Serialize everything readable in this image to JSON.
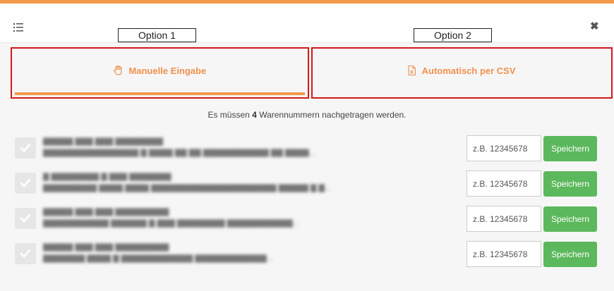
{
  "header": {
    "list_icon": "list-ordered-icon",
    "close_icon": "close-icon",
    "close_glyph": "✖"
  },
  "options": [
    {
      "label": "Option 1"
    },
    {
      "label": "Option 2"
    }
  ],
  "tabs": [
    {
      "label": "Manuelle Eingabe",
      "icon": "hand-icon",
      "active": true
    },
    {
      "label": "Automatisch per CSV",
      "icon": "excel-file-icon",
      "active": false
    }
  ],
  "info": {
    "prefix": "Es müssen",
    "count": "4",
    "suffix": "Warennummern nachgetragen werden."
  },
  "rows": [
    {
      "input_placeholder": "z.B. 12345678",
      "save_label": "Speichern"
    },
    {
      "input_placeholder": "z.B. 12345678",
      "save_label": "Speichern"
    },
    {
      "input_placeholder": "z.B. 12345678",
      "save_label": "Speichern"
    },
    {
      "input_placeholder": "z.B. 12345678",
      "save_label": "Speichern"
    }
  ],
  "colors": {
    "accent": "#f39a4b",
    "tab_text": "#f0914d",
    "highlight_border": "#d3191c",
    "save_button": "#5cb85c"
  }
}
